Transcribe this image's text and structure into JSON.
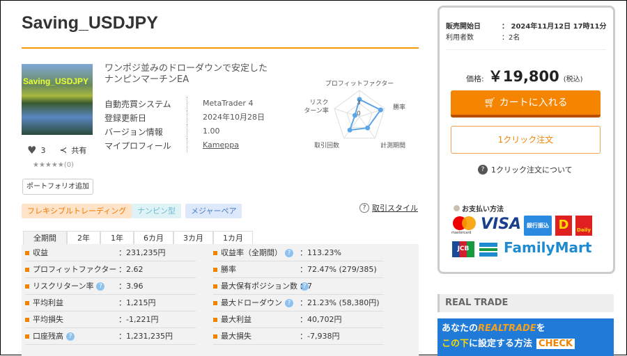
{
  "title": "Saving_USDJPY",
  "thumbnail_text": "Saving_USDJPY",
  "subtitle_line1": "ワンポジ並みのドローダウンで安定した",
  "subtitle_line2": "ナンピンマーチンEA",
  "likes": "3",
  "share": "共有",
  "rating": "★★★★★(0)",
  "portfolio_button": "ポートフォリオ追加",
  "info": [
    {
      "k": "自動売買システム",
      "v": "MetaTrader 4"
    },
    {
      "k": "登録更新日",
      "v": "2024年10月28日"
    },
    {
      "k": "バージョン情報",
      "v": "1.00"
    },
    {
      "k": "マイプロフィール",
      "v": "Kameppa"
    }
  ],
  "radar": {
    "axes": [
      "プロフィットファクター",
      "勝率",
      "計測期間",
      "取引回数",
      "リスク\nターン率"
    ],
    "labels": {
      "pf": "プロフィットファクター",
      "win": "勝率",
      "period": "計測期間",
      "count": "取引回数",
      "rr1": "リスク",
      "rr2": "ターン率"
    },
    "ticks": [
      "3",
      "0"
    ],
    "values": [
      3.3,
      4.2,
      2.6,
      3.1,
      0.9
    ],
    "max": 5,
    "color": "#5aa5e8"
  },
  "tags": [
    "フレキシブルトレーディング",
    "ナンピン型",
    "メジャーペア"
  ],
  "trade_style": "取引スタイル",
  "tabs": [
    "全期間",
    "2年",
    "1年",
    "6カ月",
    "3カ月",
    "1カ月"
  ],
  "stats_left": [
    {
      "k": "収益",
      "v": "：231,235円",
      "q": false
    },
    {
      "k": "プロフィットファクター",
      "v": "：2.62",
      "q": false
    },
    {
      "k": "リスクリターン率",
      "v": "：3.96",
      "q": true
    },
    {
      "k": "平均利益",
      "v": "：1,215円",
      "q": false
    },
    {
      "k": "平均損失",
      "v": "：-1,221円",
      "q": false
    },
    {
      "k": "口座残高",
      "v": "：1,231,235円",
      "q": true
    }
  ],
  "stats_right": [
    {
      "k": "収益率（全期間）",
      "v": "：113.23%",
      "q": true
    },
    {
      "k": "勝率",
      "v": "：72.47% (279/385)",
      "q": false
    },
    {
      "k": "最大保有ポジション数",
      "v": "：7",
      "q": true
    },
    {
      "k": "最大ドローダウン",
      "v": "：21.23% (58,380円)",
      "q": true
    },
    {
      "k": "最大利益",
      "v": "：40,702円",
      "q": false
    },
    {
      "k": "最大損失",
      "v": "：-7,938円",
      "q": false
    }
  ],
  "sidebar": {
    "sale_start_label": "販売開始日",
    "sale_start": "：  2024年11月12日 17時11分",
    "users_label": "利用者数",
    "users": "：2名",
    "price_label": "価格:",
    "price": "￥19,800",
    "tax": "(税込)",
    "cart": "カートに入れる",
    "oneclick": "1クリック注文",
    "oneclick_help": "1クリック注文について",
    "payment_title": "お支払い方法",
    "payments": {
      "mc": "mastercard",
      "visa": "VISA",
      "bank": "銀行振込",
      "d1": "D",
      "d2": "Daily",
      "jcb": "JCB",
      "fm": "FamilyMart"
    }
  },
  "real_trade": {
    "header": "REAL TRADE",
    "banner1": "あなたの",
    "banner_logo": "REALTRADE",
    "banner2": "を",
    "banner3": "この下",
    "banner4": "に設定する方法",
    "check": "CHECK"
  }
}
